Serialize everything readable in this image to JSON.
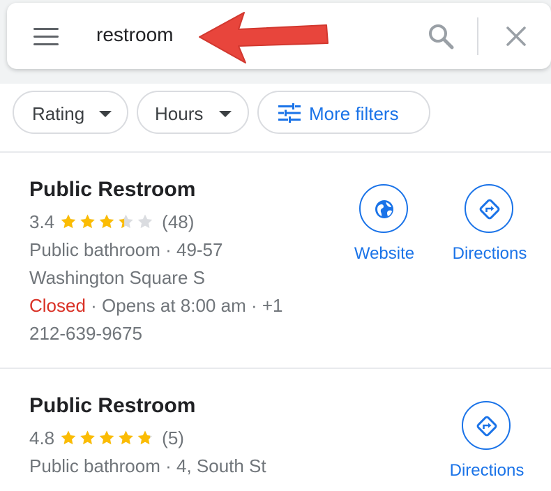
{
  "search": {
    "query": "restroom",
    "icons": [
      "menu-icon",
      "search-icon",
      "close-icon"
    ]
  },
  "annotation": {
    "arrow_color": "#e8453c"
  },
  "filters": {
    "rating": "Rating",
    "hours": "Hours",
    "more": "More filters"
  },
  "colors": {
    "accent": "#1a73e8",
    "star": "#fbbc04",
    "star_empty": "#dadce0",
    "closed": "#d93025",
    "secondary_text": "#70757a"
  },
  "results": [
    {
      "name": "Public Restroom",
      "rating": "3.4",
      "stars": 3.4,
      "reviews": "(48)",
      "category_address": "Public bathroom · 49-57",
      "address_cont": "Washington Square S",
      "status": "Closed",
      "hours_phone": " · Opens at 8:00 am · +1",
      "phone_cont": "212-639-9675",
      "actions": {
        "website": "Website",
        "directions": "Directions"
      }
    },
    {
      "name": "Public Restroom",
      "rating": "4.8",
      "stars": 4.8,
      "reviews": "(5)",
      "category_address": "Public bathroom · 4, South St",
      "actions": {
        "directions": "Directions"
      }
    }
  ]
}
